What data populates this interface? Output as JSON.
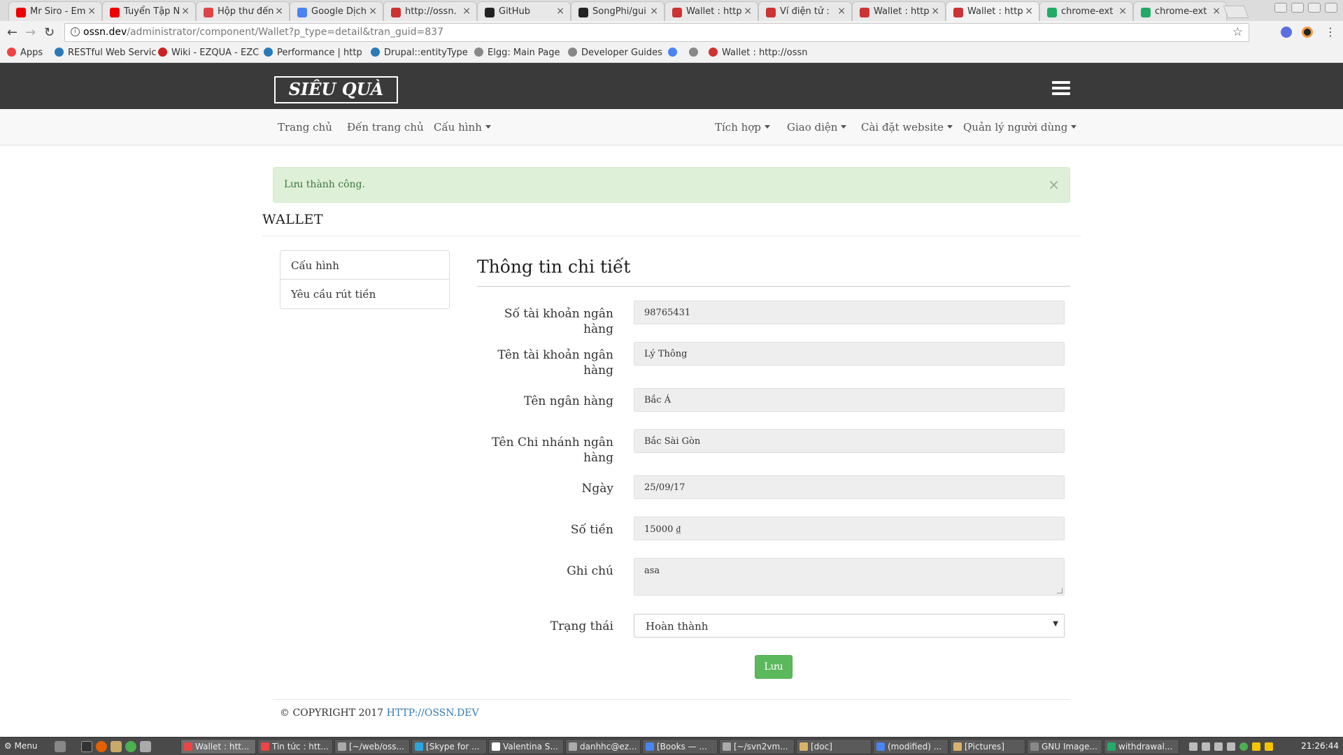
{
  "browser": {
    "tabs": [
      {
        "title": "Mr Siro - Em",
        "icon": "youtube-icon",
        "color": "#e00"
      },
      {
        "title": "Tuyển Tập N",
        "icon": "youtube-icon",
        "color": "#e00"
      },
      {
        "title": "Hộp thư đến",
        "icon": "gmail-icon",
        "color": "#d44"
      },
      {
        "title": "Google Dịch",
        "icon": "google-translate-icon",
        "color": "#4a84f4"
      },
      {
        "title": "http://ossn.",
        "icon": "ossn-icon",
        "color": "#c33"
      },
      {
        "title": "GitHub",
        "icon": "github-icon",
        "color": "#222"
      },
      {
        "title": "SongPhi/gui",
        "icon": "github-icon",
        "color": "#222"
      },
      {
        "title": "Wallet : http",
        "icon": "ossn-icon",
        "color": "#c33"
      },
      {
        "title": "Ví điện tử :",
        "icon": "ossn-icon",
        "color": "#c33"
      },
      {
        "title": "Wallet : http",
        "icon": "ossn-icon",
        "color": "#c33"
      },
      {
        "title": "Wallet : http",
        "icon": "ossn-icon",
        "color": "#c33",
        "active": true
      },
      {
        "title": "chrome-ext",
        "icon": "chrome-ext-icon",
        "color": "#2a6"
      },
      {
        "title": "chrome-ext",
        "icon": "chrome-ext-icon",
        "color": "#2a6"
      }
    ],
    "url_host": "ossn.dev",
    "url_path": "/administrator/component/Wallet?p_type=detail&tran_guid=837",
    "bookmarks": [
      {
        "label": "Apps",
        "icon": "apps-grid-icon",
        "color": "#e44"
      },
      {
        "label": "RESTful Web Servic",
        "icon": "drupal-icon",
        "color": "#2a7ab8"
      },
      {
        "label": "Wiki - EZQUA - EZC",
        "icon": "wiki-icon",
        "color": "#c22"
      },
      {
        "label": "Performance | http",
        "icon": "drupal-icon",
        "color": "#2a7ab8"
      },
      {
        "label": "Drupal::entityType",
        "icon": "drupal-icon",
        "color": "#2a7ab8"
      },
      {
        "label": "Elgg: Main Page",
        "icon": "page-icon",
        "color": "#888"
      },
      {
        "label": "Developer Guides",
        "icon": "guide-icon",
        "color": "#888"
      },
      {
        "label": "",
        "icon": "google-translate-icon",
        "color": "#4a84f4"
      },
      {
        "label": "",
        "icon": "page-icon",
        "color": "#888"
      },
      {
        "label": "Wallet : http://ossn",
        "icon": "ossn-icon",
        "color": "#c33"
      }
    ]
  },
  "site": {
    "logo": "SIÊU QUÀ",
    "nav_left": [
      "Trang chủ",
      "Đến trang chủ",
      "Cấu hình"
    ],
    "nav_right": [
      "Tích hợp",
      "Giao diện",
      "Cài đặt website",
      "Quản lý người dùng"
    ]
  },
  "alert": {
    "message": "Lưu thành công.",
    "close": "×"
  },
  "page_title": "WALLET",
  "side_menu": [
    "Cấu hình",
    "Yêu cầu rút tiền"
  ],
  "panel_title": "Thông tin chi tiết",
  "form": {
    "bank_account_number": {
      "label": "Số tài khoản ngân hàng",
      "value": "98765431"
    },
    "bank_account_name": {
      "label": "Tên tài khoản ngân hàng",
      "value": "Lý Thông"
    },
    "bank_name": {
      "label": "Tên ngân hàng",
      "value": "Bắc Á"
    },
    "branch_name": {
      "label": "Tên Chi nhánh ngân hàng",
      "value": "Bắc Sài Gòn"
    },
    "date": {
      "label": "Ngày",
      "value": "25/09/17"
    },
    "amount": {
      "label": "Số tiền",
      "value": "15000 ₫"
    },
    "note": {
      "label": "Ghi chú",
      "value": "asa"
    },
    "status": {
      "label": "Trạng thái",
      "value": "Hoàn thành"
    },
    "save_label": "Lưu"
  },
  "footer": {
    "copyright": "© COPYRIGHT 2017",
    "link": "HTTP://OSSN.DEV"
  },
  "taskbar": {
    "menu_label": "Menu",
    "items": [
      {
        "label": "Wallet : htt...",
        "color": "#e44",
        "active": true
      },
      {
        "label": "Tin tức : htt...",
        "color": "#e44"
      },
      {
        "label": "[~/web/oss...",
        "color": "#aaa"
      },
      {
        "label": "[Skype for ...",
        "color": "#2aa5e0"
      },
      {
        "label": "Valentina S...",
        "color": "#fff"
      },
      {
        "label": "danhhc@ez...",
        "color": "#aaa"
      },
      {
        "label": "[Books — ...",
        "color": "#4a84f4"
      },
      {
        "label": "[~/svn2vm...",
        "color": "#aaa"
      },
      {
        "label": "[doc]",
        "color": "#d9b26a"
      },
      {
        "label": "(modified) ...",
        "color": "#4a84f4"
      },
      {
        "label": "[Pictures]",
        "color": "#d9b26a"
      },
      {
        "label": "GNU Image...",
        "color": "#888"
      },
      {
        "label": "withdrawal...",
        "color": "#2a6"
      }
    ],
    "clock": "21:26:44"
  }
}
